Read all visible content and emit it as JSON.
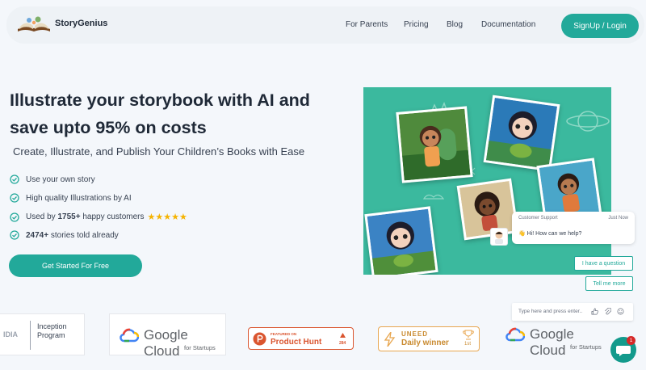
{
  "header": {
    "brand": "StoryGenius",
    "nav": [
      "For Parents",
      "Pricing",
      "Blog",
      "Documentation"
    ],
    "signup_label": "SignUp / Login"
  },
  "hero": {
    "title": "Illustrate your storybook with AI and save upto 95% on costs",
    "subtitle": "Create, Illustrate, and Publish Your Children’s Books with Ease",
    "features": {
      "f1": "Use your own story",
      "f2": "High quality Illustrations by AI",
      "f3_pre": "Used by",
      "f3_num": "1755+",
      "f3_post": "happy customers",
      "f4_num": "2474+",
      "f4_post": "stories told already"
    },
    "rating": {
      "stars": 5,
      "stars_glyph": "★★★★★"
    },
    "cta_label": "Get Started For Free"
  },
  "chat": {
    "agent": "Customer Support",
    "time": "Just Now",
    "message": "Hi! How can we help?",
    "emoji": "👋",
    "quick_replies": [
      "I have a question",
      "Tell me more"
    ],
    "input_placeholder": "Type here and press enter..",
    "unread_count": "1"
  },
  "partners": {
    "nvidia": {
      "partial": "IDIA",
      "line1": "Inception",
      "line2": "Program"
    },
    "google1": {
      "name": "Google Cloud",
      "sub": "for Startups"
    },
    "producthunt": {
      "featured": "FEATURED ON",
      "name": "Product Hunt",
      "count": "284"
    },
    "uneed": {
      "name": "UNEED",
      "title": "Daily winner",
      "rank": "1st"
    },
    "google2": {
      "name": "Google Cloud",
      "sub": "for Startups"
    }
  },
  "colors": {
    "accent": "#22a99a",
    "panel": "#3bb99e",
    "background": "#f4f7fb",
    "star": "#f5b301",
    "producthunt": "#da552f",
    "uneed": "#e8a64f"
  },
  "icons": {
    "logo": "open-book-logo",
    "check": "check-circle-icon",
    "attach": "paperclip-icon",
    "like": "thumbs-up-icon",
    "emoji": "smiley-icon",
    "launcher": "chat-bubble-icon"
  }
}
